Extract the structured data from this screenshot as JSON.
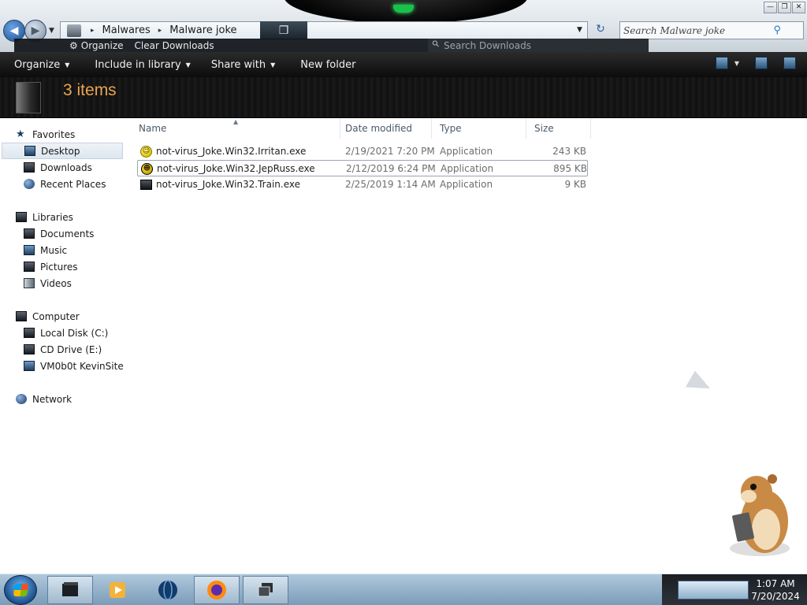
{
  "address": {
    "crumbs": [
      "Malwares",
      "Malware joke"
    ],
    "search_placeholder": "Search Malware joke"
  },
  "overlay": {
    "organize": "Organize",
    "clear": "Clear Downloads",
    "search_placeholder": "Search Downloads"
  },
  "toolbar": {
    "organize": "Organize",
    "include": "Include in library",
    "share": "Share with",
    "new_folder": "New folder"
  },
  "details": {
    "count": "3 items"
  },
  "nav": {
    "favorites": {
      "label": "Favorites",
      "items": [
        "Desktop",
        "Downloads",
        "Recent Places"
      ]
    },
    "libraries": {
      "label": "Libraries",
      "items": [
        "Documents",
        "Music",
        "Pictures",
        "Videos"
      ]
    },
    "computer": {
      "label": "Computer",
      "items": [
        "Local Disk (C:)",
        "CD Drive (E:)",
        "VM0b0t KevinSite"
      ]
    },
    "network": {
      "label": "Network"
    }
  },
  "columns": {
    "name": "Name",
    "date": "Date modified",
    "type": "Type",
    "size": "Size"
  },
  "files": [
    {
      "name": "not-virus_Joke.Win32.Irritan.exe",
      "date": "2/19/2021 7:20 PM",
      "type": "Application",
      "size": "243 KB",
      "icon": "smiley-icon"
    },
    {
      "name": "not-virus_Joke.Win32.JepRuss.exe",
      "date": "2/12/2019 6:24 PM",
      "type": "Application",
      "size": "895 KB",
      "icon": "dark-smiley-icon"
    },
    {
      "name": "not-virus_Joke.Win32.Train.exe",
      "date": "2/25/2019 1:14 AM",
      "type": "Application",
      "size": "9 KB",
      "icon": "application-icon"
    }
  ],
  "clock": {
    "time": "1:07 AM",
    "date": "7/20/2024"
  },
  "colors": {
    "accent_orange": "#e9a451",
    "toolbar_dark": "#0c0c0c",
    "taskbar_blue": "#7a9cb9"
  }
}
